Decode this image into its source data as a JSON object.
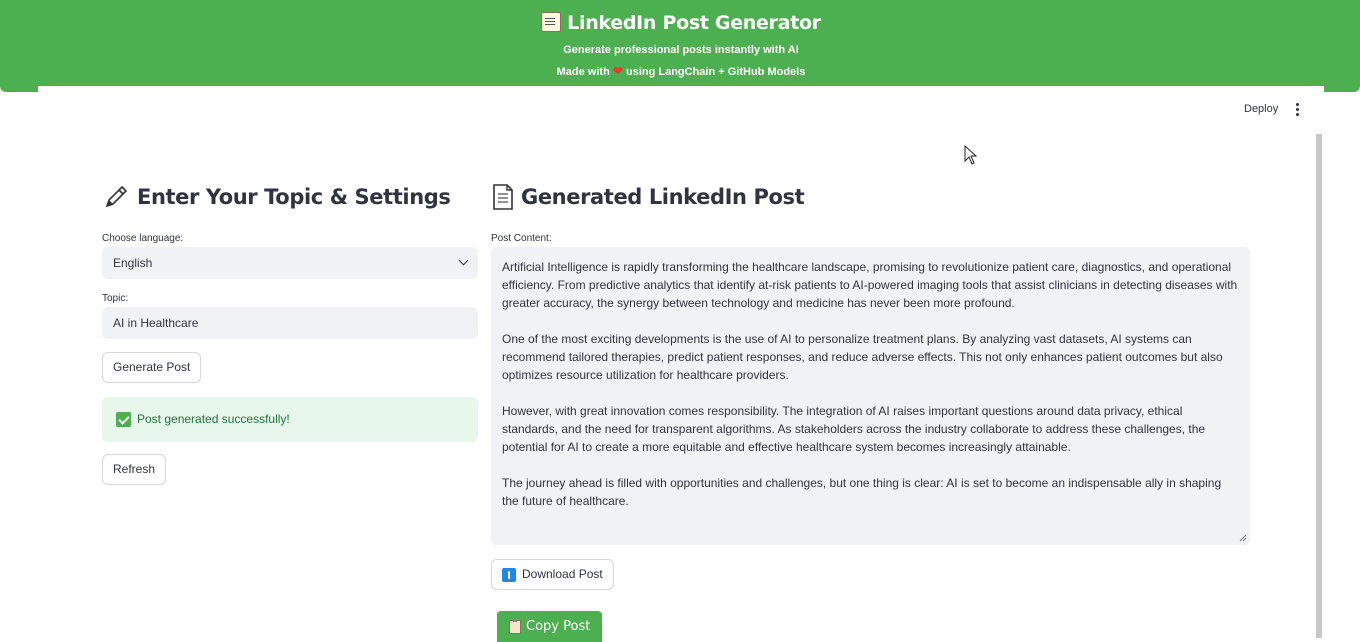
{
  "header": {
    "title": "LinkedIn Post Generator",
    "subtitle": "Generate professional posts instantly with AI",
    "made_prefix": "Made with",
    "made_suffix": "using LangChain + GitHub Models",
    "title_icon": "memo-icon",
    "heart_icon": "heart-icon",
    "color": "#4caf50"
  },
  "toolbar": {
    "deploy_label": "Deploy",
    "menu_icon": "kebab-icon"
  },
  "settings": {
    "heading": "Enter Your Topic & Settings",
    "heading_icon": "pencil-icon",
    "language_label": "Choose language:",
    "language_value": "English",
    "topic_label": "Topic:",
    "topic_value": "AI in Healthcare",
    "generate_label": "Generate Post",
    "success_message": "Post generated successfully!",
    "refresh_label": "Refresh"
  },
  "output": {
    "heading": "Generated LinkedIn Post",
    "heading_icon": "page-icon",
    "content_label": "Post Content:",
    "paragraphs": [
      "Artificial Intelligence is rapidly transforming the healthcare landscape, promising to revolutionize patient care, diagnostics, and operational efficiency. From predictive analytics that identify at-risk patients to AI-powered imaging tools that assist clinicians in detecting diseases with greater accuracy, the synergy between technology and medicine has never been more profound.",
      "One of the most exciting developments is the use of AI to personalize treatment plans. By analyzing vast datasets, AI systems can recommend tailored therapies, predict patient responses, and reduce adverse effects. This not only enhances patient outcomes but also optimizes resource utilization for healthcare providers.",
      "However, with great innovation comes responsibility. The integration of AI raises important questions around data privacy, ethical standards, and the need for transparent algorithms. As stakeholders across the industry collaborate to address these challenges, the potential for AI to create a more equitable and effective healthcare system becomes increasingly attainable.",
      "The journey ahead is filled with opportunities and challenges, but one thing is clear: AI is set to become an indispensable ally in shaping the future of healthcare."
    ],
    "download_label": "Download Post",
    "copy_label": "Copy Post"
  }
}
